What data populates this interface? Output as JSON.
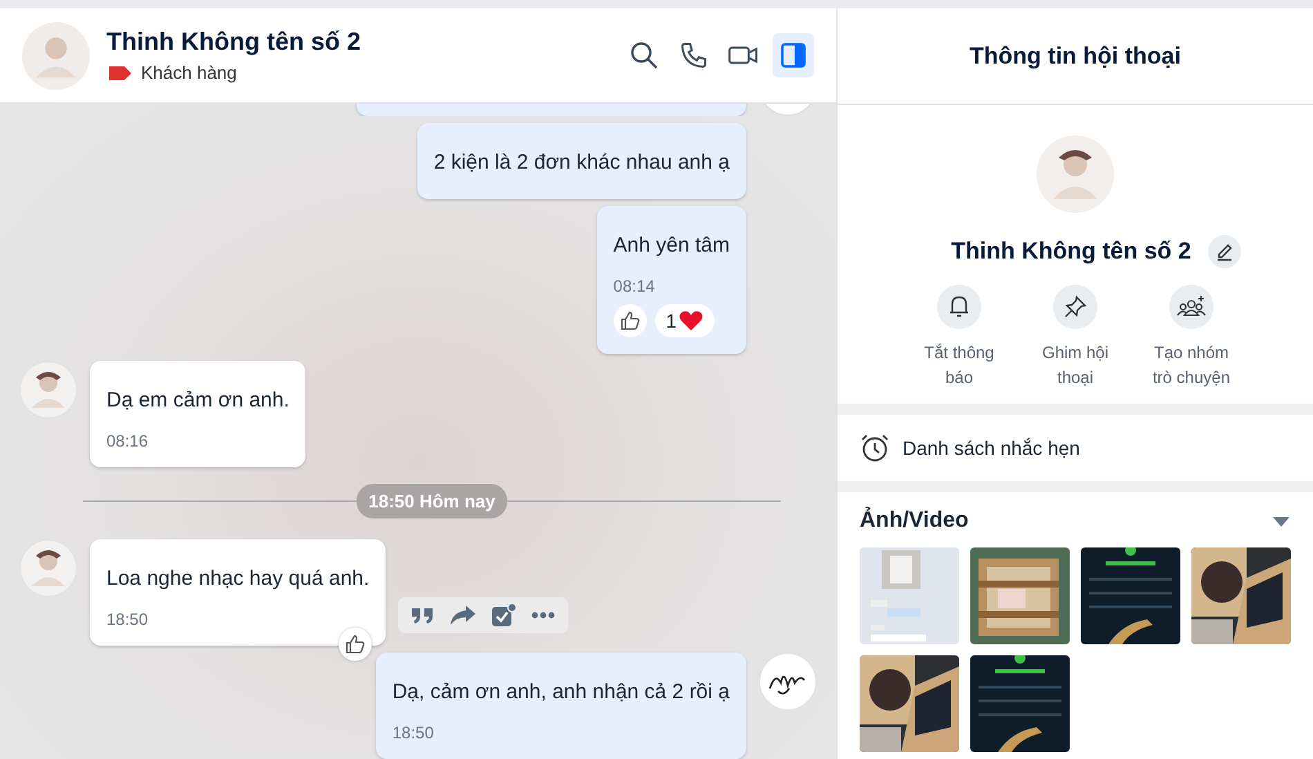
{
  "chat_header": {
    "name": "Thinh Không tên số 2",
    "tag": {
      "label": "Khách hàng",
      "color": "#e03131"
    },
    "actions": [
      {
        "kind": "search",
        "selected": false
      },
      {
        "kind": "phone",
        "selected": false
      },
      {
        "kind": "video",
        "selected": false
      },
      {
        "kind": "panel",
        "selected": true
      }
    ]
  },
  "messages": [
    {
      "kind": "cut",
      "outgoing": true,
      "show_avatar": true
    },
    {
      "kind": "message",
      "outgoing": true,
      "text": "2 kiện là 2 đơn khác nhau anh ạ",
      "show_avatar": false
    },
    {
      "kind": "message",
      "outgoing": true,
      "text": "Anh yên tâm",
      "time": "08:14",
      "show_avatar": false,
      "like_button": true,
      "reaction_count": "1"
    },
    {
      "kind": "message",
      "outgoing": false,
      "text": "Dạ em cảm ơn anh.",
      "time": "08:16",
      "show_avatar": true
    },
    {
      "kind": "divider",
      "text": "18:50 Hôm nay"
    },
    {
      "kind": "message",
      "outgoing": false,
      "text": "Loa nghe nhạc hay quá anh.",
      "time": "18:50",
      "show_avatar": true,
      "like_button": true,
      "toolbar": true
    },
    {
      "kind": "message",
      "outgoing": true,
      "text": "Dạ, cảm ơn anh, anh nhận cả 2 rồi ạ",
      "time": "18:50",
      "show_avatar": true
    }
  ],
  "info_panel": {
    "title": "Thông tin hội thoại",
    "name": "Thinh Không tên số 2",
    "actions": [
      {
        "kind": "bell",
        "label": "Tắt thông báo"
      },
      {
        "kind": "pin",
        "label": "Ghim hội thoại"
      },
      {
        "kind": "group",
        "label": "Tạo nhóm trò chuyện"
      }
    ],
    "reminder": {
      "label": "Danh sách nhắc hẹn"
    },
    "media": {
      "title": "Ảnh/Video",
      "expanded": true
    }
  }
}
